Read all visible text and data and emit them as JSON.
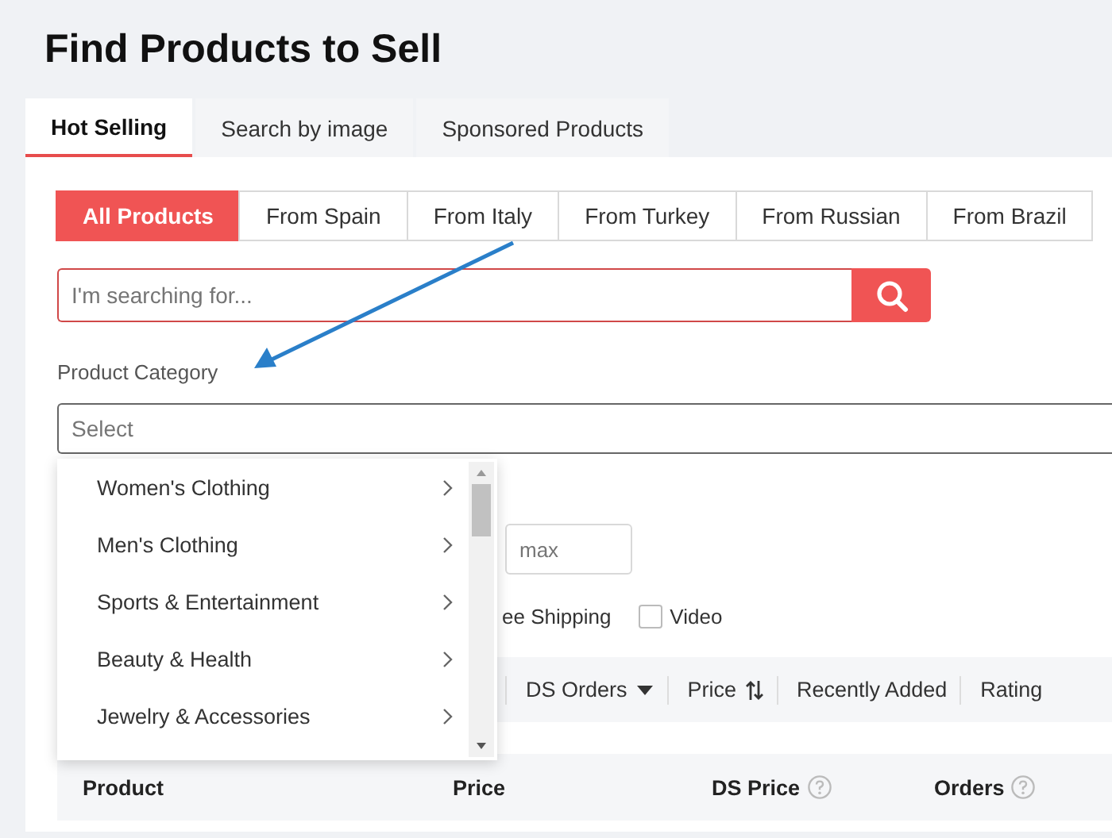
{
  "title": "Find Products to Sell",
  "tabs": [
    {
      "label": "Hot Selling",
      "selected": true
    },
    {
      "label": "Search by image",
      "selected": false
    },
    {
      "label": "Sponsored Products",
      "selected": false
    }
  ],
  "source_filters": [
    {
      "label": "All Products",
      "selected": true
    },
    {
      "label": "From Spain",
      "selected": false
    },
    {
      "label": "From Italy",
      "selected": false
    },
    {
      "label": "From Turkey",
      "selected": false
    },
    {
      "label": "From Russian",
      "selected": false
    },
    {
      "label": "From Brazil",
      "selected": false
    }
  ],
  "search": {
    "placeholder": "I'm searching for..."
  },
  "category": {
    "label": "Product Category",
    "placeholder": "Select",
    "expanded": true,
    "options": [
      {
        "label": "Women's Clothing"
      },
      {
        "label": "Men's Clothing"
      },
      {
        "label": "Sports & Entertainment"
      },
      {
        "label": "Beauty & Health"
      },
      {
        "label": "Jewelry & Accessories"
      }
    ]
  },
  "price_range": {
    "max_placeholder": "max"
  },
  "shipping_label": "ee Shipping",
  "video": {
    "label": "Video",
    "checked": false
  },
  "sort": [
    {
      "label": "DS Orders",
      "kind": "dropdown"
    },
    {
      "label": "Price",
      "kind": "sortable"
    },
    {
      "label": "Recently Added",
      "kind": "plain"
    },
    {
      "label": "Rating",
      "kind": "plain"
    }
  ],
  "table": {
    "columns": [
      {
        "label": "Product",
        "help": false
      },
      {
        "label": "Price",
        "help": false
      },
      {
        "label": "DS Price",
        "help": true
      },
      {
        "label": "Orders",
        "help": true
      }
    ]
  }
}
